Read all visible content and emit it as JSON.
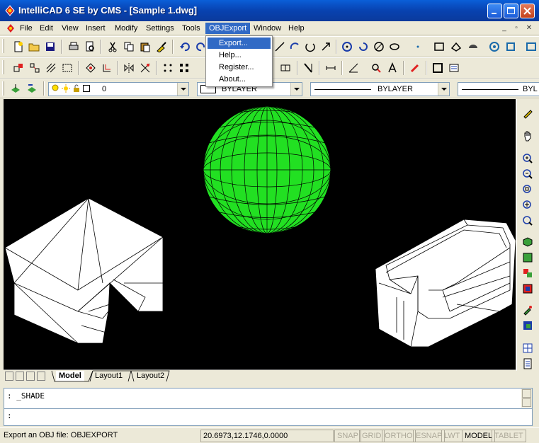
{
  "window": {
    "title": "IntelliCAD 6 SE by CMS - [Sample 1.dwg]"
  },
  "menu": {
    "items": [
      "File",
      "Edit",
      "View",
      "Insert",
      "Modify",
      "Settings",
      "Tools",
      "OBJExport",
      "Window",
      "Help"
    ],
    "active": "OBJExport"
  },
  "dropdown": {
    "items": [
      "Export...",
      "Help...",
      "Register...",
      "About..."
    ],
    "highlighted": "Export..."
  },
  "properties": {
    "layer": "0",
    "color": "BYLAYER",
    "linetype": "BYLAYER",
    "lineweight": "BYL"
  },
  "tabs": [
    "Model",
    "Layout1",
    "Layout2"
  ],
  "command": {
    "history": ": _SHADE",
    "prompt": ":"
  },
  "status": {
    "message": "Export an OBJ file: OBJEXPORT",
    "coordinates": "20.6973,12.1746,0.0000",
    "toggles": [
      {
        "label": "SNAP",
        "on": false
      },
      {
        "label": "GRID",
        "on": false
      },
      {
        "label": "ORTHO",
        "on": false
      },
      {
        "label": "ESNAP",
        "on": false
      },
      {
        "label": "LWT",
        "on": false
      },
      {
        "label": "MODEL",
        "on": true
      },
      {
        "label": "TABLET",
        "on": false
      }
    ]
  },
  "colors": {
    "titlebar": "#0a5fd8",
    "menu_highlight": "#316ac5",
    "viewport_bg": "#000000",
    "sphere": "#22e022"
  }
}
